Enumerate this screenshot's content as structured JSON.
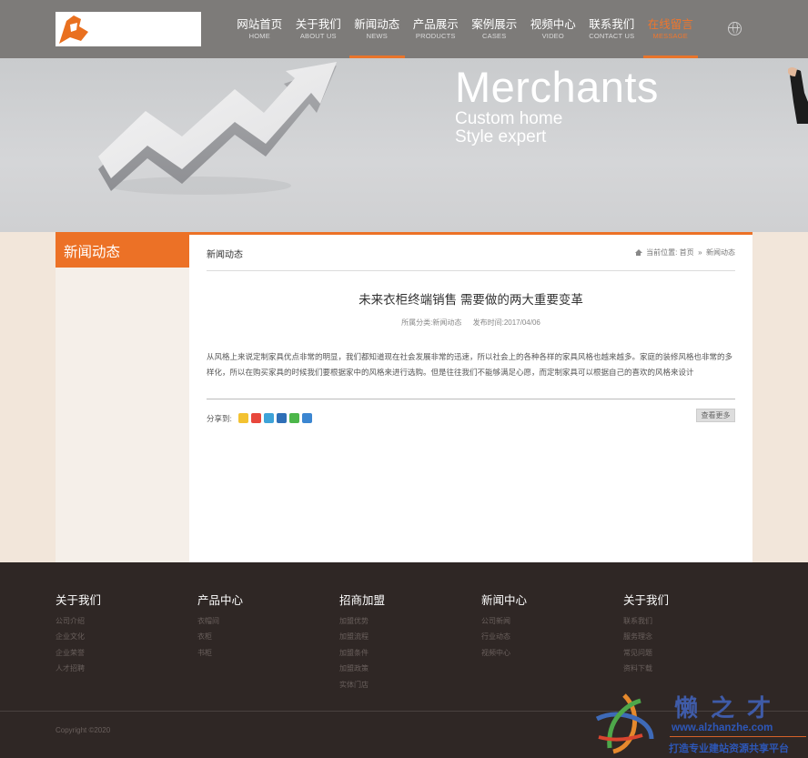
{
  "nav": {
    "items": [
      {
        "cn": "网站首页",
        "en": "HOME"
      },
      {
        "cn": "关于我们",
        "en": "ABOUT US"
      },
      {
        "cn": "新闻动态",
        "en": "NEWS"
      },
      {
        "cn": "产品展示",
        "en": "PRODUCTS"
      },
      {
        "cn": "案例展示",
        "en": "CASES"
      },
      {
        "cn": "视频中心",
        "en": "VIDEO"
      },
      {
        "cn": "联系我们",
        "en": "CONTACT US"
      },
      {
        "cn": "在线留言",
        "en": "MESSAGE"
      }
    ],
    "active_index": 2,
    "highlight_index": 7,
    "accent_color": "#ec7126"
  },
  "banner": {
    "title": "Merchants",
    "subtitle_1": "Custom home",
    "subtitle_2": "Style expert"
  },
  "sidebar": {
    "title": "新闻动态"
  },
  "content": {
    "section_title": "新闻动态",
    "breadcrumb_prefix": "当前位置:",
    "breadcrumb_home": "首页",
    "breadcrumb_sep": "»",
    "breadcrumb_current": "新闻动态",
    "article_title": "未来衣柜终端销售 需要做的两大重要变革",
    "category_label": "所属分类:新闻动态",
    "date_label": "发布时间:2017/04/06",
    "body": "从风格上来说定制家具优点非常的明显，我们都知道现在社会发展非常的迅速，所以社会上的各种各样的家具风格也越来越多。家庭的装修风格也非常的多样化，所以在购买家具的时候我们要根据家中的风格来进行选购。但是往往我们不能够满足心愿，而定制家具可以根据自己的喜欢的风格来设计",
    "share_label": "分享到:",
    "share_icons": [
      "qzone-icon",
      "weibo-icon",
      "tencent-weibo-icon",
      "renren-icon",
      "wechat-icon",
      "more-share-icon"
    ],
    "more_button": "查看更多"
  },
  "footer": {
    "columns": [
      {
        "title": "关于我们",
        "links": [
          "公司介绍",
          "企业文化",
          "企业荣誉",
          "人才招聘"
        ]
      },
      {
        "title": "产品中心",
        "links": [
          "衣帽间",
          "衣柜",
          "书柜"
        ]
      },
      {
        "title": "招商加盟",
        "links": [
          "加盟优势",
          "加盟流程",
          "加盟条件",
          "加盟政策",
          "实体门店"
        ]
      },
      {
        "title": "新闻中心",
        "links": [
          "公司新闻",
          "行业动态",
          "视频中心"
        ]
      },
      {
        "title": "关于我们",
        "links": [
          "联系我们",
          "服务理念",
          "常见问题",
          "资料下载"
        ]
      }
    ],
    "copyright": "Copyright ©2020"
  },
  "watermark": {
    "cn": "懒之才",
    "url": "www.alzhanzhe.com",
    "slogan": "打造专业建站资源共享平台"
  }
}
